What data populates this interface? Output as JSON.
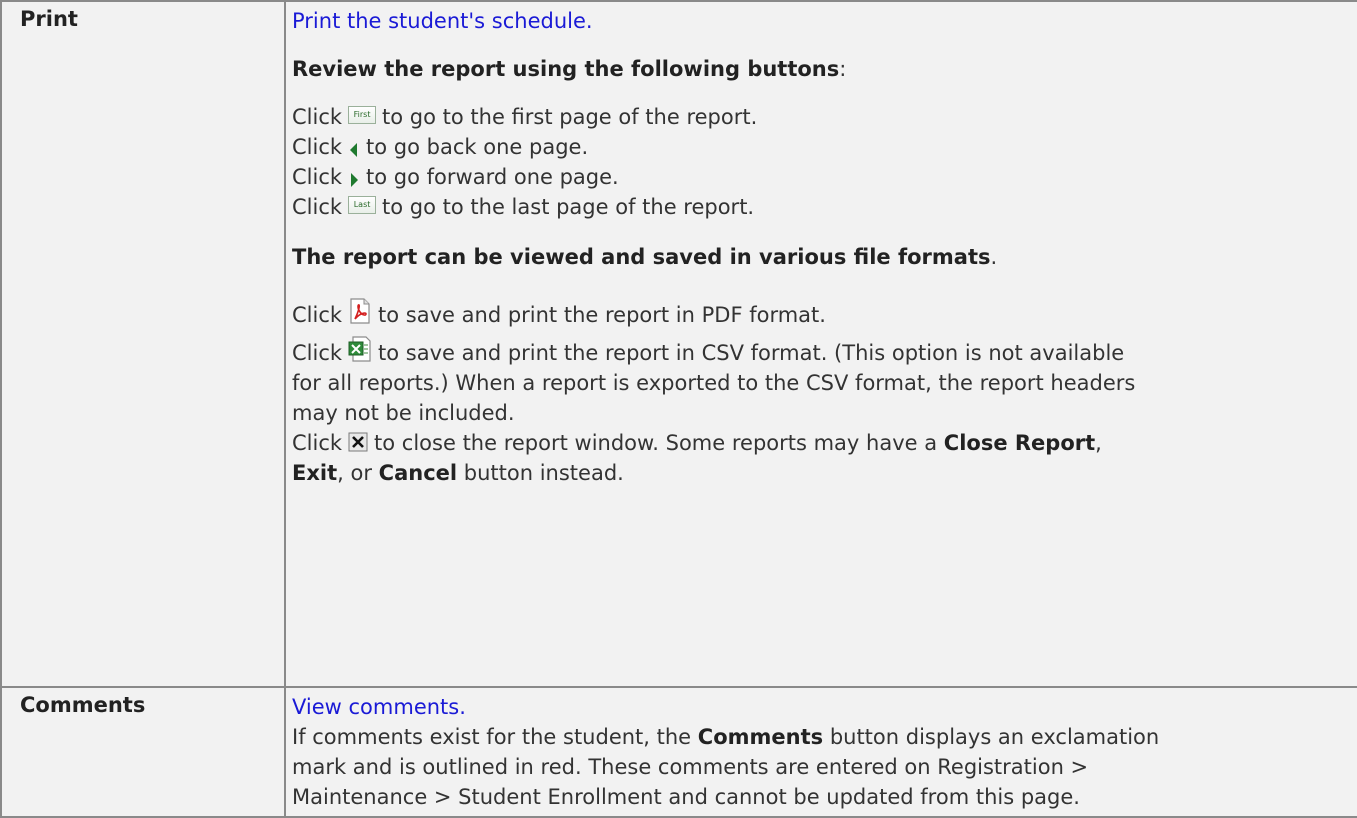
{
  "rows": [
    {
      "label": "Print",
      "link": "Print the student's schedule.",
      "review_heading": "Review the report using the following buttons",
      "review_colon": ":",
      "nav_lines": [
        {
          "pre": "Click",
          "icon_text": "First",
          "post": "to go to the first page of the report."
        },
        {
          "pre": "Click",
          "post": "to go back one page."
        },
        {
          "pre": "Click",
          "post": "to go forward one page."
        },
        {
          "pre": "Click",
          "icon_text": "Last",
          "post": "to go to the last page of the report."
        }
      ],
      "formats_heading": "The report can be viewed and saved in various file formats",
      "formats_period": ".",
      "pdf_line": {
        "pre": "Click",
        "post": "to save and print the report in PDF format."
      },
      "csv_lines": [
        "to save and print the report in CSV format. (This option is not available",
        "for all reports.) When a report is exported to the CSV format, the report headers",
        "may not be included."
      ],
      "csv_pre": "Click",
      "close_line": {
        "pre": "Click",
        "post": "to close the report window. Some reports may have a",
        "bold1": "Close Report",
        "comma1": ",",
        "bold2": "Exit",
        "mid": ", or",
        "bold3": "Cancel",
        "end": "button instead."
      }
    },
    {
      "label": "Comments",
      "link": "View comments.",
      "text1_pre": "If comments exist for the student, the",
      "text1_bold": "Comments",
      "text1_post": "button displays an exclamation",
      "text2": "mark and is outlined in red. These comments are entered on Registration >",
      "text3": "Maintenance > Student Enrollment and cannot be updated from this page."
    }
  ],
  "icons": {
    "first": "first-page-button-icon",
    "back": "back-arrow-icon",
    "forward": "forward-arrow-icon",
    "last": "last-page-button-icon",
    "pdf": "pdf-icon",
    "csv": "csv-excel-icon",
    "close": "close-x-icon"
  },
  "colors": {
    "link": "#1a1ad6",
    "cell_bg": "#f2f2f2",
    "border": "#8a8a8a"
  }
}
